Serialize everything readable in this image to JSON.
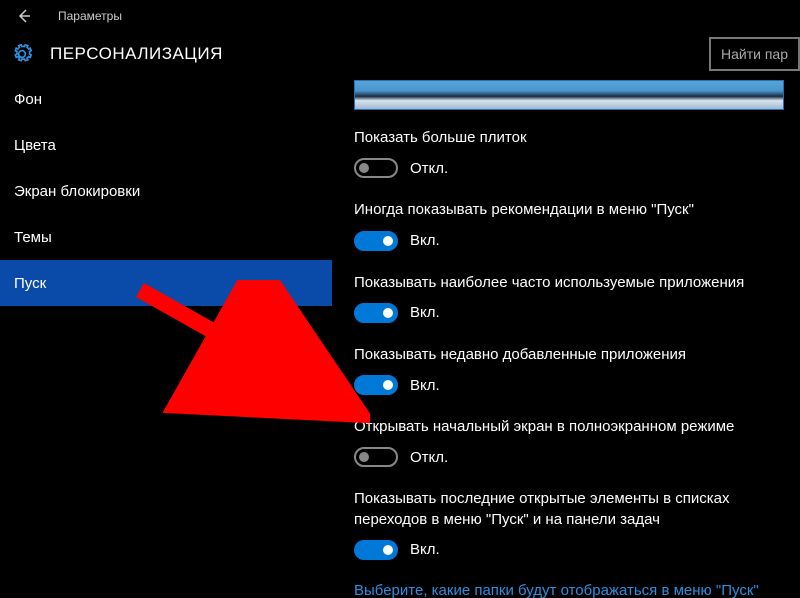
{
  "window": {
    "title": "Параметры"
  },
  "header": {
    "page_title": "ПЕРСОНАЛИЗАЦИЯ",
    "search_placeholder": "Найти пар"
  },
  "sidebar": {
    "items": [
      {
        "label": "Фон"
      },
      {
        "label": "Цвета"
      },
      {
        "label": "Экран блокировки"
      },
      {
        "label": "Темы"
      },
      {
        "label": "Пуск"
      }
    ]
  },
  "main": {
    "settings": [
      {
        "label": "Показать больше плиток",
        "on": false,
        "state_label": "Откл."
      },
      {
        "label": "Иногда показывать рекомендации в меню \"Пуск\"",
        "on": true,
        "state_label": "Вкл."
      },
      {
        "label": "Показывать наиболее часто используемые приложения",
        "on": true,
        "state_label": "Вкл."
      },
      {
        "label": "Показывать недавно добавленные приложения",
        "on": true,
        "state_label": "Вкл."
      },
      {
        "label": "Открывать начальный экран в полноэкранном режиме",
        "on": false,
        "state_label": "Откл."
      },
      {
        "label": "Показывать последние открытые элементы в списках переходов в меню \"Пуск\" и на панели задач",
        "on": true,
        "state_label": "Вкл."
      }
    ],
    "link": "Выберите, какие папки будут отображаться в меню \"Пуск\""
  },
  "arrow": {
    "color": "#ff0000"
  }
}
